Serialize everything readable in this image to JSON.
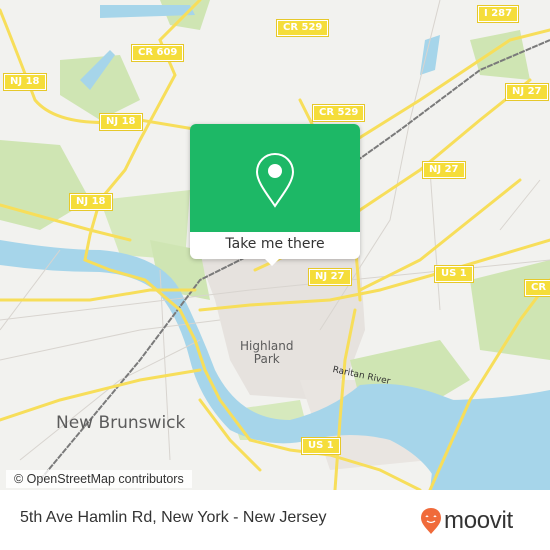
{
  "map": {
    "road_shields": [
      {
        "label": "CR 609",
        "id": "cr-609"
      },
      {
        "label": "NJ 18",
        "id": "nj-18-a"
      },
      {
        "label": "NJ 18",
        "id": "nj-18-b"
      },
      {
        "label": "NJ 18",
        "id": "nj-18-c"
      },
      {
        "label": "CR 529",
        "id": "cr-529-a"
      },
      {
        "label": "CR 529",
        "id": "cr-529-b"
      },
      {
        "label": "I 287",
        "id": "i-287"
      },
      {
        "label": "NJ 27",
        "id": "nj-27-a"
      },
      {
        "label": "NJ 27",
        "id": "nj-27-b"
      },
      {
        "label": "NJ 27",
        "id": "nj-27-c"
      },
      {
        "label": "US 1",
        "id": "us-1-a"
      },
      {
        "label": "US 1",
        "id": "us-1-b"
      },
      {
        "label": "CR",
        "id": "cr-east"
      }
    ],
    "places": {
      "highland_park": "Highland\nPark",
      "new_brunswick": "New Brunswick",
      "raritan_river": "Raritan River"
    },
    "attribution": "© OpenStreetMap contributors",
    "colors": {
      "land": "#f2f2ef",
      "park": "#c8e2a8",
      "water": "#a6d5ea",
      "road_major": "#f7de5a",
      "rail": "#777777",
      "urban": "#e3dfdb"
    }
  },
  "popup": {
    "button_label": "Take me there",
    "color": "#1db866"
  },
  "footer": {
    "title": "5th Ave Hamlin Rd, New York - New Jersey",
    "brand": "moovit",
    "brand_color": "#f06a3a"
  }
}
